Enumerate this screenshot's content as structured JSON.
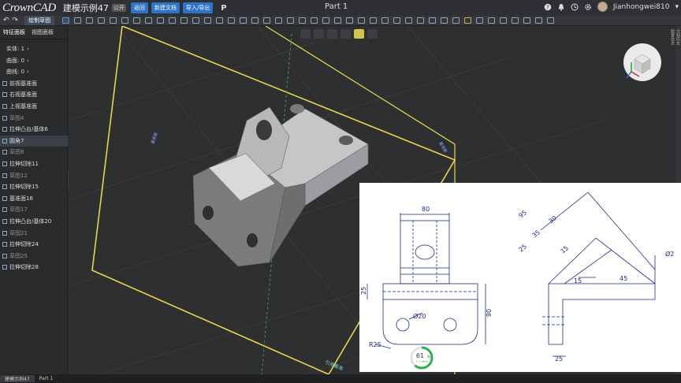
{
  "header": {
    "brand": "CrownCAD",
    "doc_title": "建模示例47",
    "doc_badge": "公开",
    "buttons": [
      "返回",
      "新建文档",
      "导入/导出"
    ],
    "p_label": "P",
    "part_title": "Part 1",
    "username": "Jianhongwei810",
    "icons": [
      "help-icon",
      "bell-icon",
      "clock-icon",
      "gear-icon"
    ]
  },
  "toolbar": {
    "active_tab": "绘制草图"
  },
  "left_panel": {
    "tabs": [
      "特征面板",
      "视图面板"
    ],
    "items": [
      {
        "label": "实体: 1",
        "type": "group"
      },
      {
        "label": "曲面: 0",
        "type": "group"
      },
      {
        "label": "曲线: 0",
        "type": "group"
      },
      {
        "label": "前视基准面",
        "type": "plane"
      },
      {
        "label": "右视基准面",
        "type": "plane"
      },
      {
        "label": "上视基准面",
        "type": "plane"
      },
      {
        "label": "草图4",
        "type": "sketch"
      },
      {
        "label": "拉伸凸台/基体6",
        "type": "feature"
      },
      {
        "label": "圆角7",
        "type": "feature"
      },
      {
        "label": "草图8",
        "type": "sketch"
      },
      {
        "label": "拉伸切除11",
        "type": "feature"
      },
      {
        "label": "草图12",
        "type": "sketch"
      },
      {
        "label": "拉伸切除15",
        "type": "feature"
      },
      {
        "label": "基准面16",
        "type": "plane"
      },
      {
        "label": "草图17",
        "type": "sketch"
      },
      {
        "label": "拉伸凸台/基体20",
        "type": "feature"
      },
      {
        "label": "草图21",
        "type": "sketch"
      },
      {
        "label": "拉伸切除24",
        "type": "feature"
      },
      {
        "label": "草图25",
        "type": "sketch"
      },
      {
        "label": "拉伸切除28",
        "type": "feature"
      }
    ]
  },
  "right_strip": [
    "文档历史",
    "配置信息"
  ],
  "viewport": {
    "plane_labels": [
      "基准面",
      "基准面",
      "引用基准"
    ]
  },
  "drawing": {
    "dims": [
      "80",
      "95",
      "30",
      "35",
      "25",
      "15",
      "15",
      "45",
      "Ø2",
      "25",
      "Ø20",
      "90",
      "R25",
      "25"
    ],
    "progress_value": 61,
    "progress_unit": "%",
    "progress_sub": "↑ 0.4K/s"
  },
  "statusbar": {
    "items": [
      "建模示例47",
      "Part 1"
    ]
  }
}
